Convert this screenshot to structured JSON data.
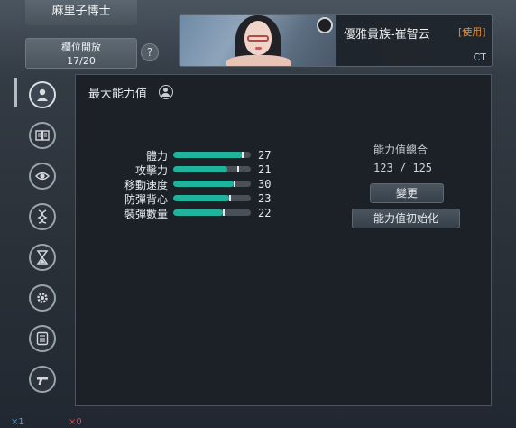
{
  "header": {
    "character_title": "麻里子博士",
    "slot_label": "欄位開放",
    "slot_count": "17/20",
    "help": "?"
  },
  "banner": {
    "character_name": "優雅貴族-崔智云",
    "status_tag": "[使用]",
    "class_tag": "CT"
  },
  "sidebar": {
    "items": [
      {
        "icon": "user-icon",
        "active": true
      },
      {
        "icon": "book-icon"
      },
      {
        "icon": "eye-icon"
      },
      {
        "icon": "dna-icon"
      },
      {
        "icon": "hourglass-icon"
      },
      {
        "icon": "gear-icon"
      },
      {
        "icon": "list-icon"
      },
      {
        "icon": "gun-icon"
      }
    ]
  },
  "panel": {
    "title": "最大能力值",
    "stats": [
      {
        "label": "體力",
        "value": "27",
        "fill": 0.9,
        "max": 0.88
      },
      {
        "label": "攻擊力",
        "value": "21",
        "fill": 0.7,
        "max": 0.83
      },
      {
        "label": "移動速度",
        "value": "30",
        "fill": 0.78,
        "max": 0.78
      },
      {
        "label": "防彈背心",
        "value": "23",
        "fill": 0.72,
        "max": 0.72
      },
      {
        "label": "裝彈數量",
        "value": "22",
        "fill": 0.64,
        "max": 0.64
      }
    ],
    "total_label": "能力值總合",
    "total_value": "123 / 125",
    "change_button": "變更",
    "reset_button": "能力值初始化"
  },
  "footer": {
    "counter_a": "×1",
    "counter_b": "×0"
  },
  "colors": {
    "bar_fill": "#1fb39b",
    "tag_orange": "#f08a2a",
    "class_blue": "#b9d8f2"
  }
}
